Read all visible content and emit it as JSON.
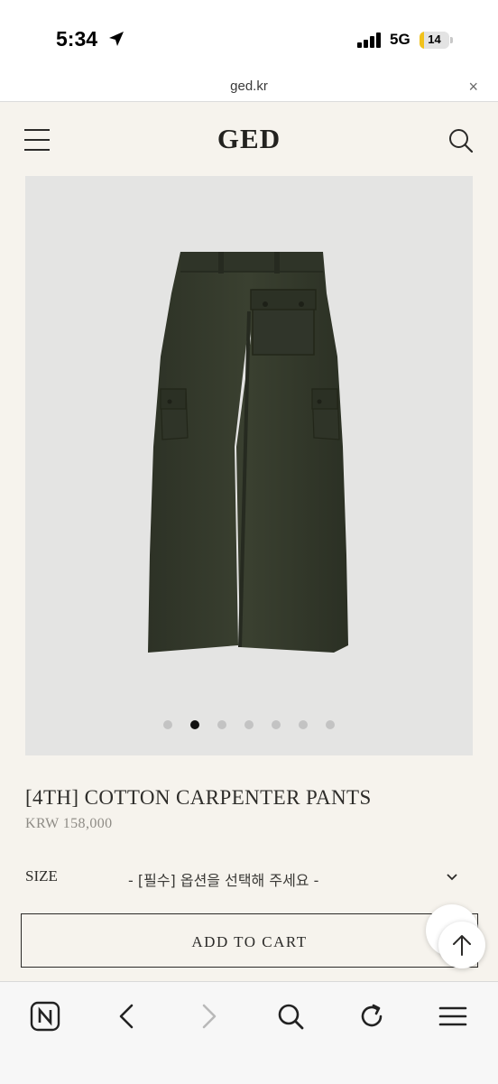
{
  "status_bar": {
    "time": "5:34",
    "network": "5G",
    "battery": "14",
    "battery_level_percent": 14,
    "location_icon": "location-arrow-icon",
    "signal_icon": "cellular-signal-icon"
  },
  "browser": {
    "url": "ged.kr",
    "close_symbol": "×"
  },
  "header": {
    "logo": "GED",
    "menu_icon": "hamburger-menu-icon",
    "search_icon": "search-icon"
  },
  "gallery": {
    "slide_count": 7,
    "active_slide": 2,
    "image_subject": "olive green cotton carpenter pants"
  },
  "product": {
    "title": "[4TH] COTTON CARPENTER PANTS",
    "price": "KRW 158,000",
    "size_label": "SIZE",
    "size_placeholder": "- [필수] 옵션을 선택해 주세요 -",
    "add_to_cart": "ADD TO CART"
  },
  "toolbar": {
    "icons": [
      "naver-icon",
      "back-arrow-icon",
      "forward-arrow-icon",
      "search-icon",
      "reload-icon",
      "menu-icon"
    ]
  },
  "colors": {
    "page_background": "#f6f3ed",
    "image_background": "#e4e4e3",
    "pants": "#33392b",
    "battery": "#f1c21b",
    "text": "#2b2a28",
    "price_text": "#8f8c86"
  }
}
